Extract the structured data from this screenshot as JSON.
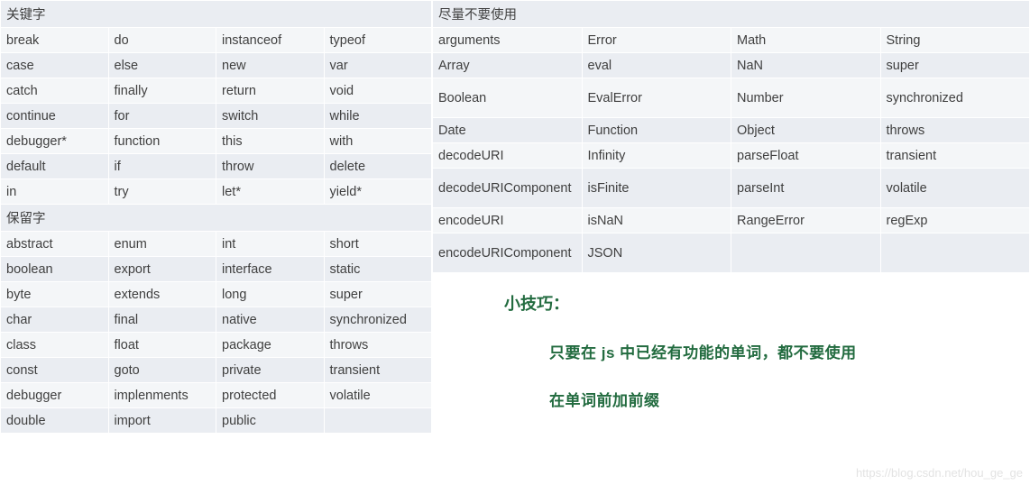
{
  "leftTable": {
    "header1": "关键字",
    "keywords": [
      [
        "break",
        "do",
        "instanceof",
        "typeof"
      ],
      [
        "case",
        "else",
        "new",
        "var"
      ],
      [
        "catch",
        "finally",
        "return",
        "void"
      ],
      [
        "continue",
        "for",
        "switch",
        "while"
      ],
      [
        "debugger*",
        "function",
        "this",
        "with"
      ],
      [
        "default",
        "if",
        "throw",
        "delete"
      ],
      [
        "in",
        "try",
        "let*",
        "yield*"
      ]
    ],
    "header2": "保留字",
    "reserved": [
      [
        "abstract",
        "enum",
        "int",
        "short"
      ],
      [
        "boolean",
        "export",
        "interface",
        "static"
      ],
      [
        "byte",
        "extends",
        "long",
        "super"
      ],
      [
        "char",
        "final",
        "native",
        "synchronized"
      ],
      [
        "class",
        "float",
        "package",
        "throws"
      ],
      [
        "const",
        "goto",
        "private",
        "transient"
      ],
      [
        "debugger",
        "implenments",
        "protected",
        "volatile"
      ],
      [
        "double",
        "import",
        "public",
        ""
      ]
    ]
  },
  "rightTable": {
    "header": "尽量不要使用",
    "rows": [
      {
        "cells": [
          "arguments",
          "Error",
          "Math",
          "String"
        ],
        "tall": false
      },
      {
        "cells": [
          "Array",
          "eval",
          "NaN",
          "super"
        ],
        "tall": false
      },
      {
        "cells": [
          "Boolean",
          "EvalError",
          "Number",
          "synchronized"
        ],
        "tall": true
      },
      {
        "cells": [
          "Date",
          "Function",
          "Object",
          "throws"
        ],
        "tall": false
      },
      {
        "cells": [
          "decodeURI",
          "Infinity",
          "parseFloat",
          "transient"
        ],
        "tall": false
      },
      {
        "cells": [
          "decodeURIComponent",
          "isFinite",
          "parseInt",
          "volatile"
        ],
        "tall": true
      },
      {
        "cells": [
          "encodeURI",
          "isNaN",
          "RangeError",
          "regExp"
        ],
        "tall": false
      },
      {
        "cells": [
          "encodeURIComponent",
          "JSON",
          "",
          ""
        ],
        "tall": true
      }
    ]
  },
  "tips": {
    "heading": "小技巧：",
    "line1_prefix": "只要在 ",
    "line1_js": "js",
    "line1_suffix": " 中已经有功能的单词，都不要使用",
    "line2": "在单词前加前缀"
  },
  "watermark": "https://blog.csdn.net/hou_ge_ge"
}
